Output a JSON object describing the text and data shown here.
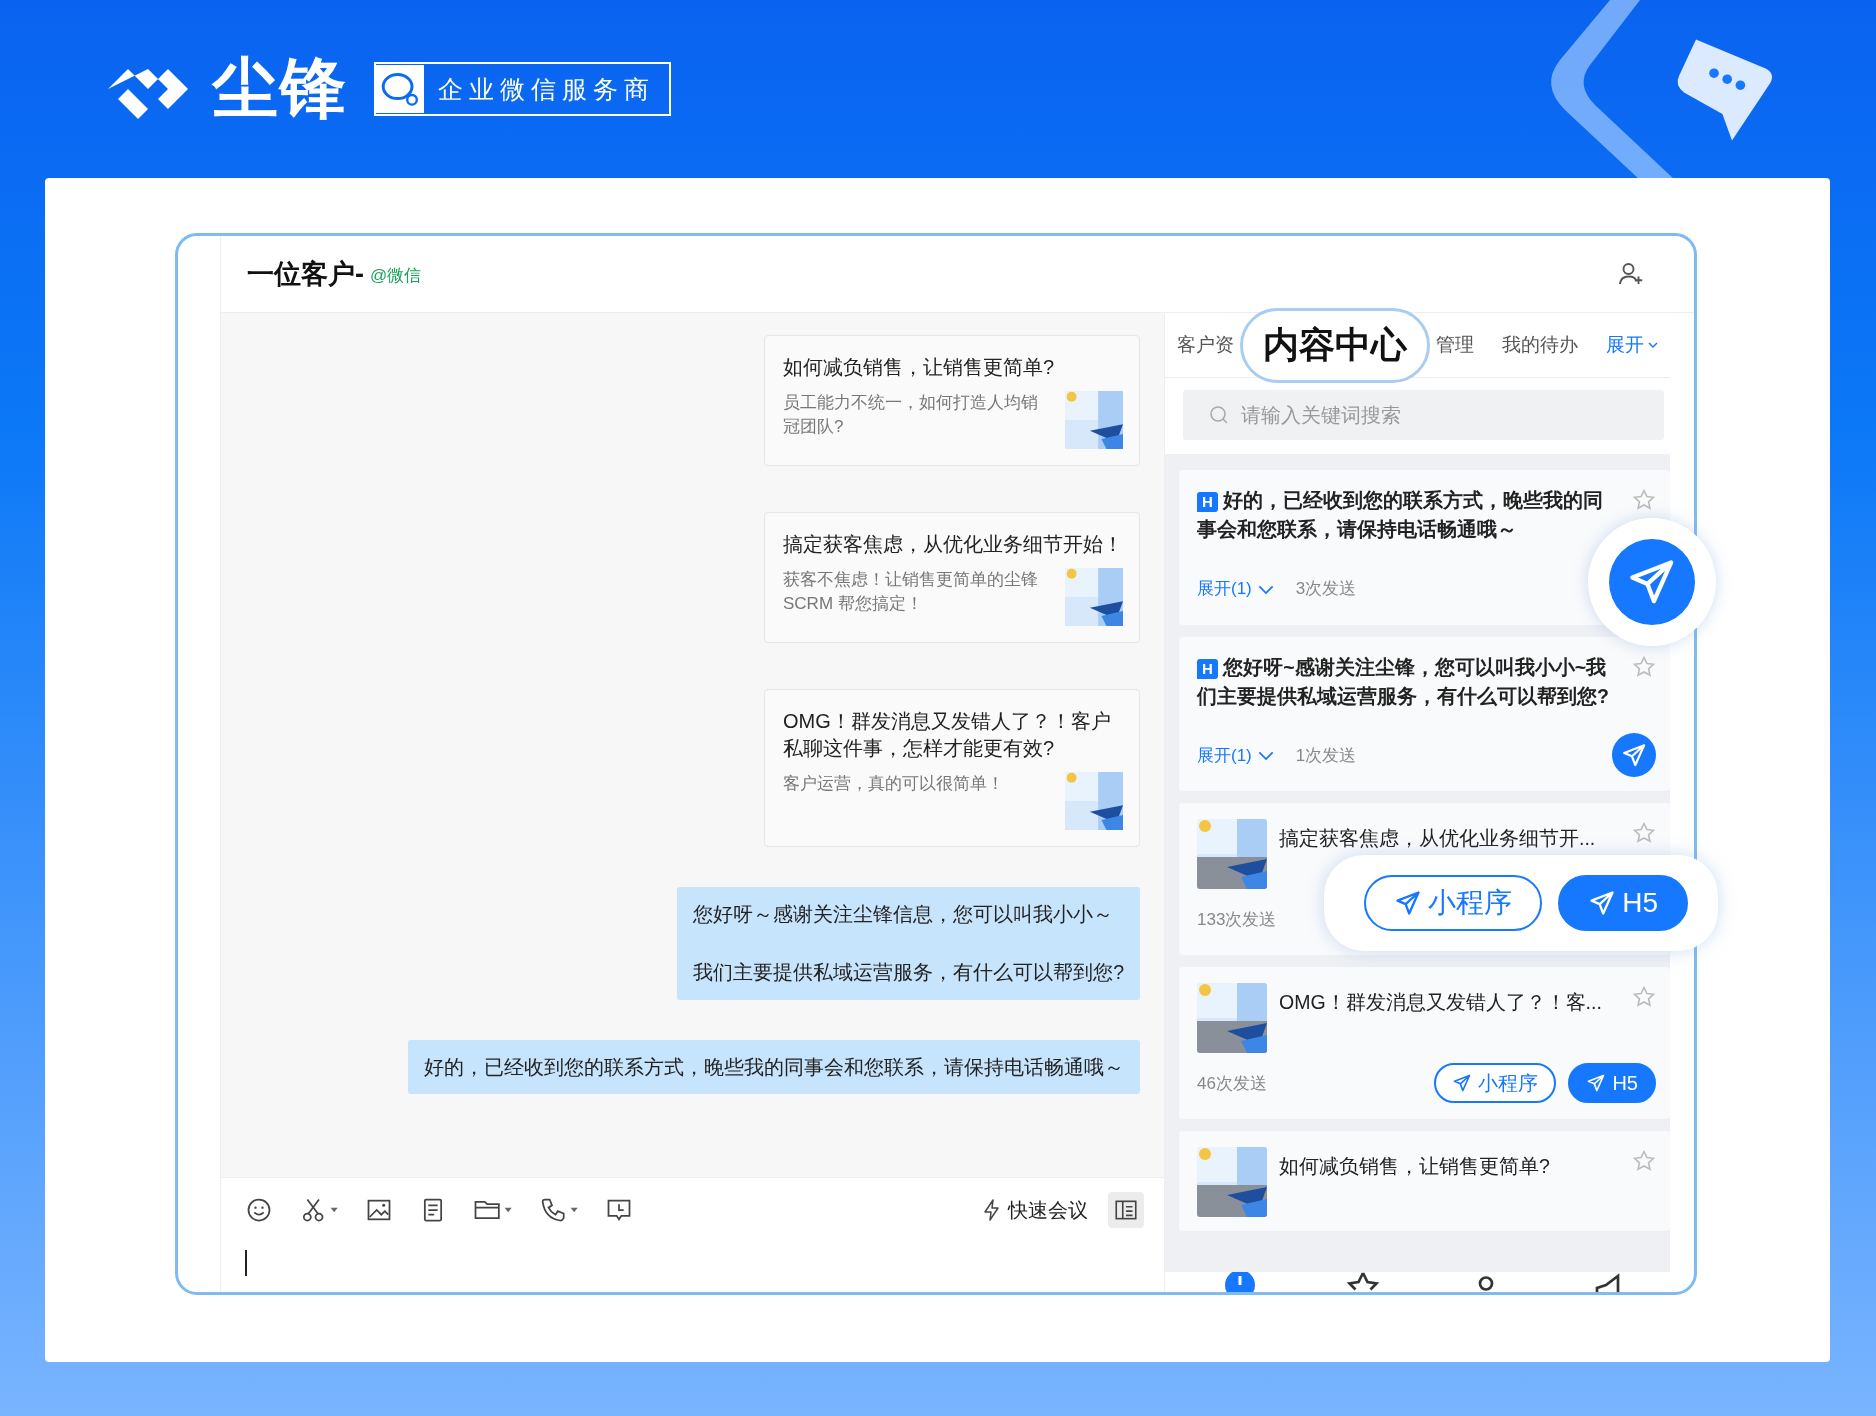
{
  "brand": {
    "name": "尘锋",
    "badge": "企业微信服务商"
  },
  "chat": {
    "title": "一位客户-",
    "channel": "@微信",
    "messages": [
      {
        "kind": "card",
        "title": "如何减负销售，让销售更简单?",
        "desc": "员工能力不统一，如何打造人均销冠团队?"
      },
      {
        "kind": "card",
        "title": "搞定获客焦虑，从优化业务细节开始！",
        "desc": "获客不焦虑！让销售更简单的尘锋SCRM 帮您搞定！"
      },
      {
        "kind": "card",
        "title": "OMG！群发消息又发错人了？！客户私聊这件事，怎样才能更有效?",
        "desc": "客户运营，真的可以很简单！"
      },
      {
        "kind": "text",
        "paragraphs": [
          "您好呀～感谢关注尘锋信息，您可以叫我小小～",
          "我们主要提供私域运营服务，有什么可以帮到您?"
        ]
      },
      {
        "kind": "text",
        "paragraphs": [
          "好的，已经收到您的联系方式，晚些我的同事会和您联系，请保持电话畅通哦～"
        ]
      }
    ],
    "toolbar": {
      "meeting": "快速会议",
      "panel_toggle_selected": true
    }
  },
  "panel": {
    "tabs": [
      {
        "label": "客户资",
        "selected": false
      },
      {
        "label": "内容中心",
        "selected": true
      },
      {
        "label": "管理",
        "selected": false
      },
      {
        "label": "我的待办",
        "selected": false
      }
    ],
    "more": "展开",
    "search": {
      "placeholder": "请输入关键词搜索"
    },
    "items": [
      {
        "kind": "text",
        "badge": "H",
        "title": "好的，已经收到您的联系方式，晚些我的同事会和您联系，请保持电话畅通哦～",
        "starred": false,
        "expand": "展开(1)",
        "count": "3次发送",
        "zoomed": true
      },
      {
        "kind": "text",
        "badge": "H",
        "title": "您好呀~感谢关注尘锋，您可以叫我小小~我们主要提供私域运营服务，有什么可以帮到您?",
        "starred": false,
        "expand": "展开(1)",
        "count": "1次发送",
        "zoomed": false
      },
      {
        "kind": "article",
        "title": "搞定获客焦虑，从优化业务细节开...",
        "starred": false,
        "count": "133次发送",
        "zoomed": true,
        "buttons": [
          {
            "label": "小程序",
            "kind": "outline"
          },
          {
            "label": "H5",
            "kind": "filled"
          }
        ]
      },
      {
        "kind": "article",
        "title": "OMG！群发消息又发错人了？！客...",
        "starred": false,
        "count": "46次发送",
        "zoomed": false,
        "buttons": [
          {
            "label": "小程序",
            "kind": "outline"
          },
          {
            "label": "H5",
            "kind": "filled"
          }
        ]
      },
      {
        "kind": "article",
        "title": "如何减负销售，让销售更简单?",
        "starred": false
      }
    ]
  }
}
